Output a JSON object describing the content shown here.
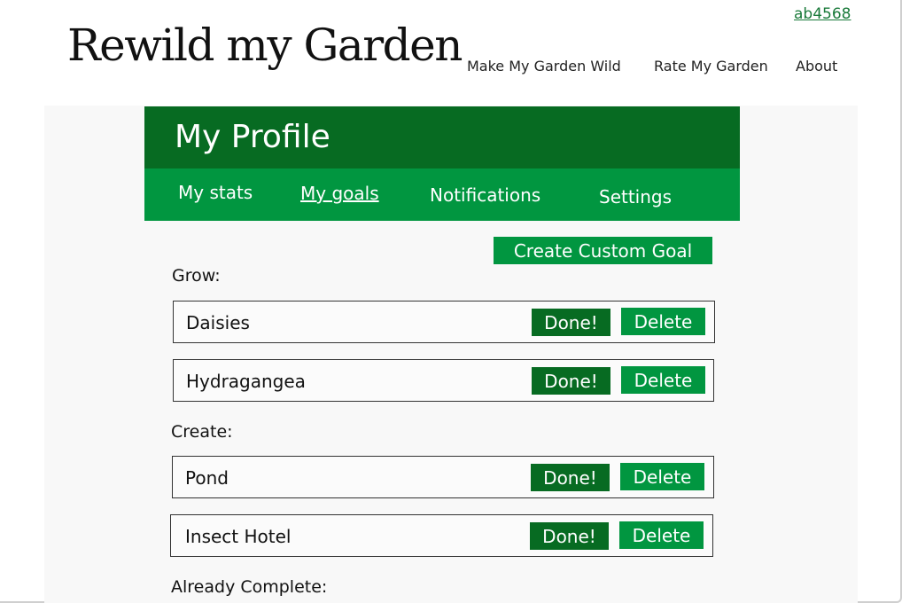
{
  "site": {
    "logo_text": "Rewild my Garden",
    "user_link": "ab4568",
    "nav": [
      {
        "label": "Make My Garden Wild"
      },
      {
        "label": "Rate My Garden"
      },
      {
        "label": "About"
      }
    ]
  },
  "profile": {
    "title": "My Profile",
    "tabs": [
      {
        "label": "My stats",
        "active": false
      },
      {
        "label": "My goals",
        "active": true
      },
      {
        "label": "Notifications",
        "active": false
      },
      {
        "label": "Settings",
        "active": false
      }
    ]
  },
  "goals": {
    "create_button": "Create Custom Goal",
    "done_label": "Done!",
    "delete_label": "Delete",
    "sections": [
      {
        "label": "Grow:",
        "items": [
          {
            "name": "Daisies"
          },
          {
            "name": "Hydragangea"
          }
        ]
      },
      {
        "label": "Create:",
        "items": [
          {
            "name": "Pond"
          },
          {
            "name": "Insect Hotel"
          }
        ]
      },
      {
        "label": "Already Complete:",
        "items": []
      }
    ]
  },
  "colors": {
    "dark_green": "#076b22",
    "green": "#019640",
    "link_green": "#1a7a3a"
  }
}
